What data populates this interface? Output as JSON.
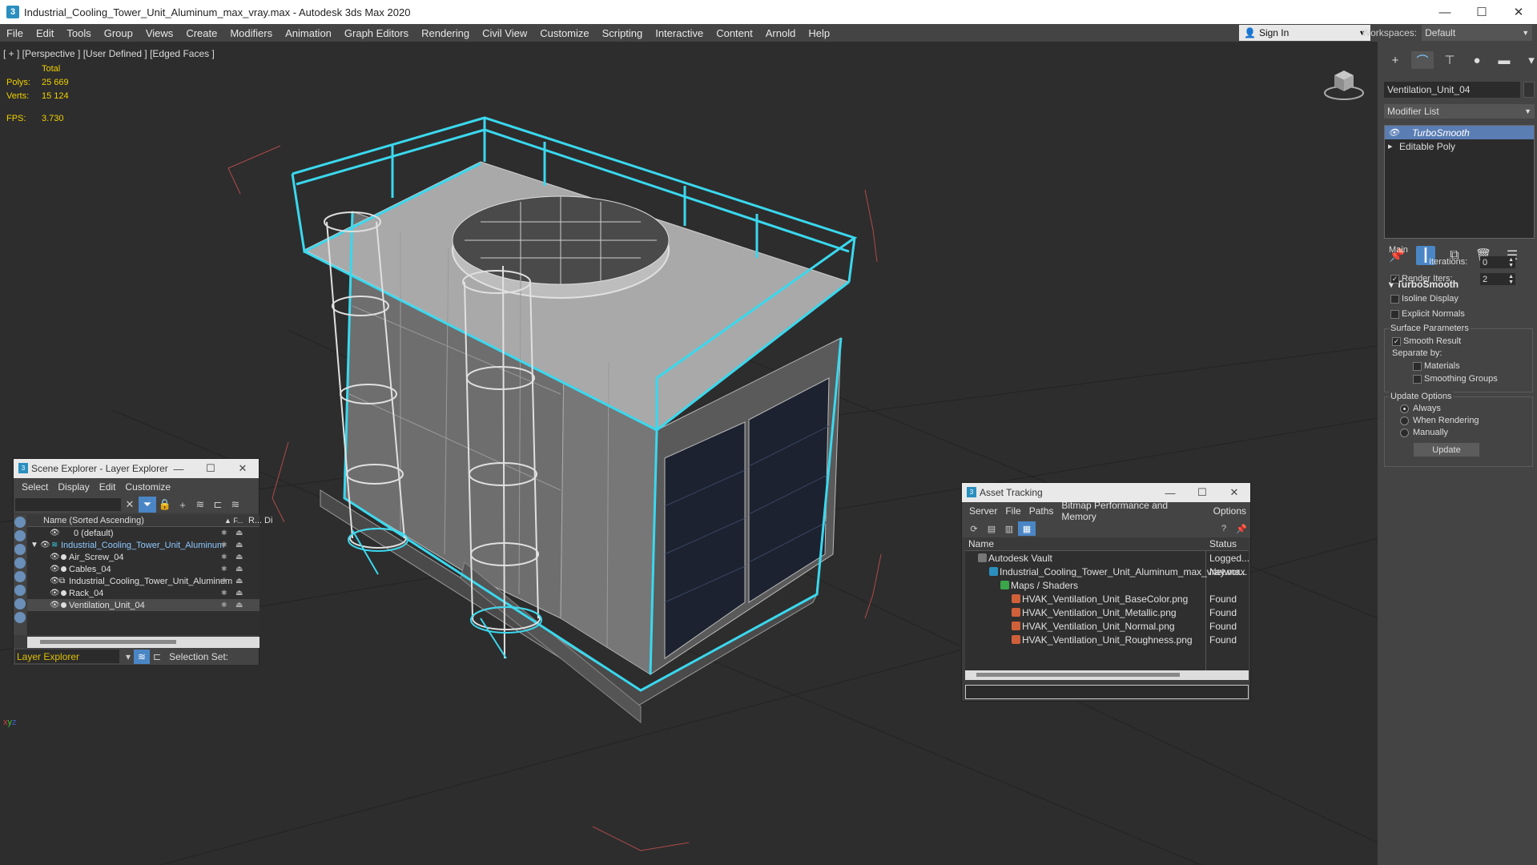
{
  "window": {
    "title": "Industrial_Cooling_Tower_Unit_Aluminum_max_vray.max - Autodesk 3ds Max 2020",
    "minimize": "—",
    "maximize": "☐",
    "close": "✕"
  },
  "menu": [
    "File",
    "Edit",
    "Tools",
    "Group",
    "Views",
    "Create",
    "Modifiers",
    "Animation",
    "Graph Editors",
    "Rendering",
    "Civil View",
    "Customize",
    "Scripting",
    "Interactive",
    "Content",
    "Arnold",
    "Help"
  ],
  "signin": {
    "label": "Sign In"
  },
  "workspaces": {
    "label": "Workspaces:",
    "value": "Default"
  },
  "viewport": {
    "label": "[ + ] [Perspective ] [User Defined ] [Edged Faces ]",
    "stats": {
      "total_label": "Total",
      "polys_label": "Polys:",
      "polys_value": "25 669",
      "verts_label": "Verts:",
      "verts_value": "15 124",
      "fps_label": "FPS:",
      "fps_value": "3.730"
    },
    "wire_color": "#3ad8ee",
    "stats_color": "#f0d000"
  },
  "command_panel": {
    "object_name": "Ventilation_Unit_04",
    "modifier_list": "Modifier List",
    "stack": [
      {
        "label": "TurboSmooth",
        "selected": true
      },
      {
        "label": "Editable Poly",
        "selected": false
      }
    ],
    "rollout": {
      "title": "TurboSmooth",
      "main_label": "Main",
      "iterations_label": "Iterations:",
      "iterations_value": "0",
      "render_iters_label": "Render Iters:",
      "render_iters_value": "2",
      "isoline_label": "Isoline Display",
      "explicit_normals_label": "Explicit Normals",
      "surface_params_label": "Surface Parameters",
      "smooth_result_label": "Smooth Result",
      "separate_by_label": "Separate by:",
      "materials_label": "Materials",
      "smoothing_groups_label": "Smoothing Groups",
      "update_options_label": "Update Options",
      "always_label": "Always",
      "when_rendering_label": "When Rendering",
      "manually_label": "Manually",
      "update_button": "Update"
    }
  },
  "scene_explorer": {
    "title": "Scene Explorer - Layer Explorer",
    "menu": [
      "Select",
      "Display",
      "Edit",
      "Customize"
    ],
    "column_name": "Name (Sorted Ascending)",
    "column_f": "▲ F...",
    "column_r": "R...",
    "column_d": "Di",
    "rows": [
      {
        "name": "0 (default)",
        "indent": 0,
        "selected": false
      },
      {
        "name": "Industrial_Cooling_Tower_Unit_Aluminum",
        "indent": 0,
        "selected": false,
        "highlight": true
      },
      {
        "name": "Air_Screw_04",
        "indent": 1,
        "selected": false
      },
      {
        "name": "Cables_04",
        "indent": 1,
        "selected": false
      },
      {
        "name": "Industrial_Cooling_Tower_Unit_Aluminum",
        "indent": 1,
        "selected": false
      },
      {
        "name": "Rack_04",
        "indent": 1,
        "selected": false
      },
      {
        "name": "Ventilation_Unit_04",
        "indent": 1,
        "selected": true
      }
    ],
    "footer_dropdown": "Layer Explorer",
    "selection_set_label": "Selection Set:"
  },
  "asset_tracking": {
    "title": "Asset Tracking",
    "menu": [
      "Server",
      "File",
      "Paths",
      "Bitmap Performance and Memory",
      "Options"
    ],
    "col_name": "Name",
    "col_status": "Status",
    "rows": [
      {
        "name": "Autodesk Vault",
        "status": "Logged...",
        "indent": 1
      },
      {
        "name": "Industrial_Cooling_Tower_Unit_Aluminum_max_vray.max",
        "status": "Networ...",
        "indent": 2
      },
      {
        "name": "Maps / Shaders",
        "status": "",
        "indent": 3
      },
      {
        "name": "HVAK_Ventilation_Unit_BaseColor.png",
        "status": "Found",
        "indent": 4
      },
      {
        "name": "HVAK_Ventilation_Unit_Metallic.png",
        "status": "Found",
        "indent": 4
      },
      {
        "name": "HVAK_Ventilation_Unit_Normal.png",
        "status": "Found",
        "indent": 4
      },
      {
        "name": "HVAK_Ventilation_Unit_Roughness.png",
        "status": "Found",
        "indent": 4
      }
    ]
  }
}
